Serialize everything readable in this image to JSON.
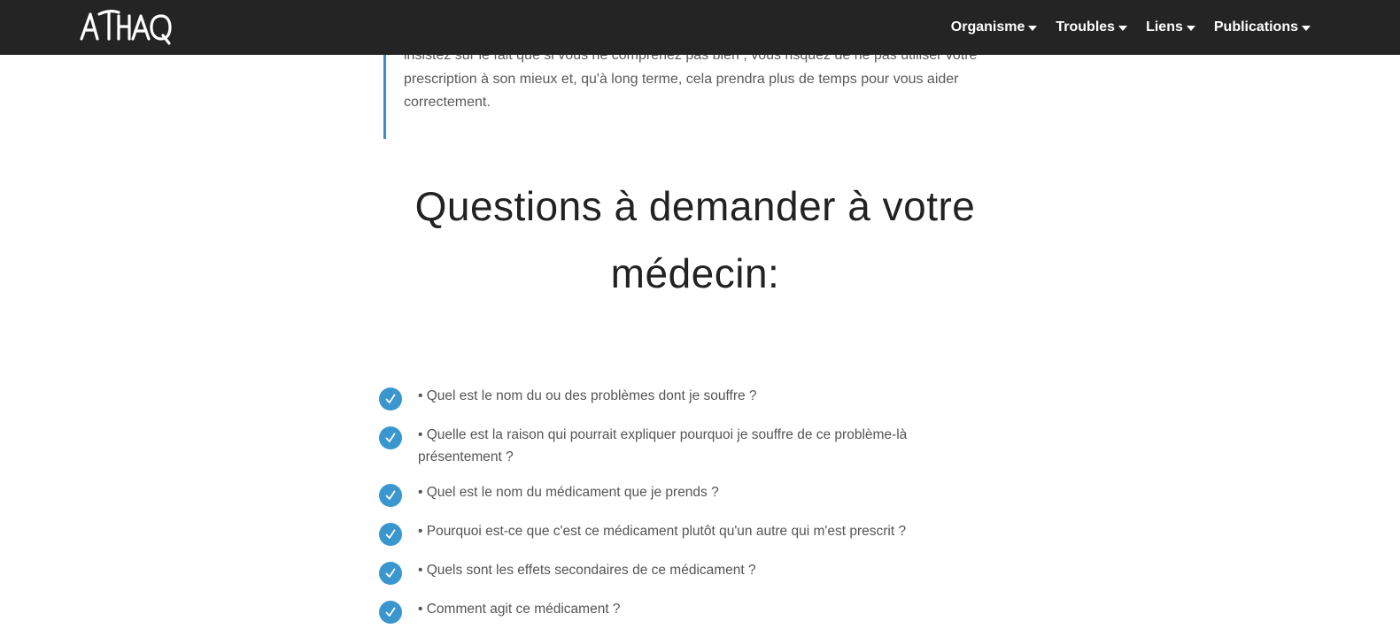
{
  "header": {
    "logo_text": "ATHAQ",
    "nav": [
      {
        "label": "Organisme"
      },
      {
        "label": "Troubles"
      },
      {
        "label": "Liens"
      },
      {
        "label": "Publications"
      }
    ]
  },
  "quote": {
    "text": "insistez sur le fait que si vous ne comprenez pas bien , vous risquez de ne pas utiliser votre prescription à son mieux et, qu'à long terme, cela prendra plus de temps pour vous aider correctement."
  },
  "section": {
    "heading_line1": "Questions à demander à votre",
    "heading_line2": "médecin:"
  },
  "checklist": [
    "• Quel est le nom du ou des problèmes dont je souffre ?",
    "• Quelle est la raison qui pourrait expliquer pourquoi je souffre de ce problème-là présentement ?",
    "• Quel est le nom du médicament que je prends ?",
    "• Pourquoi est-ce que c'est ce médicament plutôt qu'un autre qui m'est prescrit ?",
    "• Quels sont les effets secondaires de ce médicament ?",
    "• Comment agit ce médicament ?"
  ],
  "colors": {
    "header_bg": "#242424",
    "accent": "#3a96cf",
    "body_text": "#555555",
    "heading_text": "#222222"
  }
}
